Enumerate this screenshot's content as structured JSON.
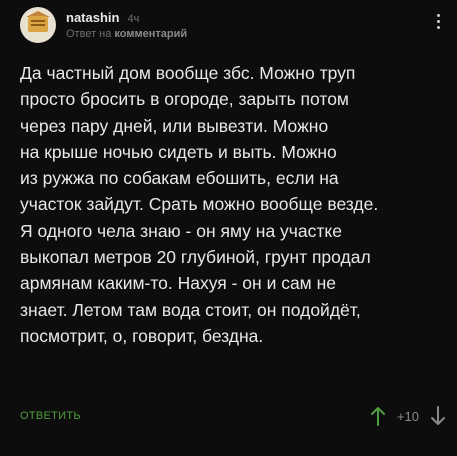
{
  "comment": {
    "author": "natashin",
    "time": "4ч",
    "reply_prefix": "Ответ на",
    "reply_link": "комментарий",
    "text_lines": [
      "Да частный дом вообще збс. Можно труп",
      "просто бросить в огороде, зарыть потом",
      "через пару дней, или вывезти. Можно",
      "на крыше ночью сидеть и выть. Можно",
      "из ружжа по собакам ебошить, если на",
      "участок зайдут. Срать можно вообще везде.",
      "Я одного чела знаю - он яму на участке",
      "выкопал метров 20 глубиной, грунт продал",
      "армянам каким-то. Нахуя - он и сам не",
      "знает. Летом там вода стоит, он подойдёт,",
      "посмотрит, о, говорит, бездна."
    ],
    "reply_button": "ОТВЕТИТЬ",
    "rating": "+10"
  },
  "colors": {
    "background": "#0d0d0d",
    "text": "#e8e8e8",
    "muted": "#6f6f6f",
    "accent_green": "#4e9f3d"
  },
  "icons": {
    "menu": "more-vertical-icon",
    "upvote": "arrow-up-icon",
    "downvote": "arrow-down-icon"
  }
}
